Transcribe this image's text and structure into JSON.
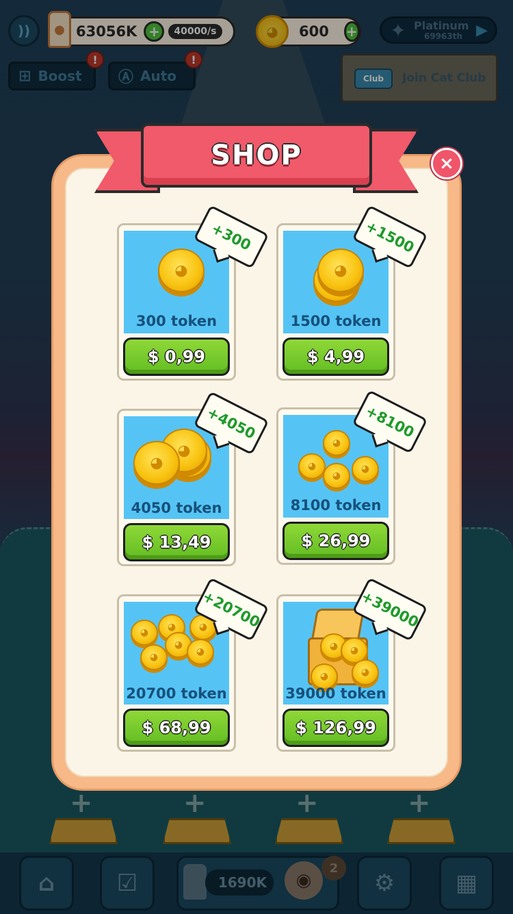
{
  "hud": {
    "food_amount": "63056K",
    "food_rate": "40000/s",
    "coins": "600",
    "rank_title": "Platinum",
    "rank_position": "69963th",
    "boost_label": "Boost",
    "auto_label": "Auto",
    "club_label": "Join Cat Club",
    "club_sign": "Club",
    "alert": "!"
  },
  "shop": {
    "title": "SHOP",
    "close": "×",
    "products": [
      {
        "label": "300 token",
        "price": "$ 0,99",
        "bonus": "+300"
      },
      {
        "label": "1500 token",
        "price": "$ 4,99",
        "bonus": "+1500"
      },
      {
        "label": "4050 token",
        "price": "$ 13,49",
        "bonus": "+4050"
      },
      {
        "label": "8100 token",
        "price": "$ 26,99",
        "bonus": "+8100"
      },
      {
        "label": "20700 token",
        "price": "$ 68,99",
        "bonus": "+20700"
      },
      {
        "label": "39000 token",
        "price": "$ 126,99",
        "bonus": "+39000"
      }
    ]
  },
  "bottom": {
    "food_amount": "1690K",
    "cat_count": "2"
  },
  "icons": {
    "signal": "signal-icon",
    "plus": "+",
    "play": "play-icon",
    "coin": "cat-coin-icon"
  },
  "colors": {
    "ribbon": "#f05a6a",
    "buy_button": "#62bd22",
    "card_image_bg": "#55c4f5",
    "bonus_text": "#1f9a2c"
  }
}
